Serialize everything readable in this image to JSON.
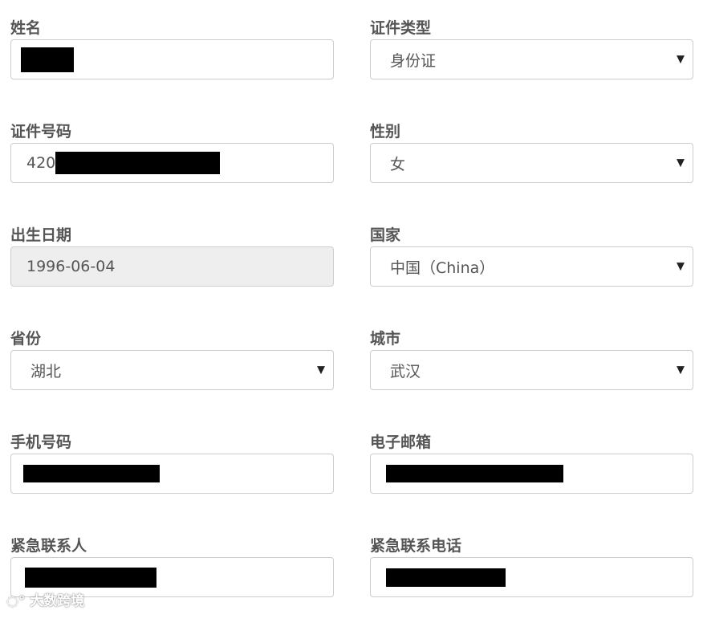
{
  "fields": {
    "name": {
      "label": "姓名"
    },
    "id_type": {
      "label": "证件类型",
      "value": "身份证"
    },
    "id_number": {
      "label": "证件号码",
      "value_prefix": "420"
    },
    "gender": {
      "label": "性别",
      "value": "女"
    },
    "birth_date": {
      "label": "出生日期",
      "value": "1996-06-04"
    },
    "country": {
      "label": "国家",
      "value": "中国（China）"
    },
    "province": {
      "label": "省份",
      "value": "湖北"
    },
    "city": {
      "label": "城市",
      "value": "武汉"
    },
    "phone": {
      "label": "手机号码"
    },
    "email": {
      "label": "电子邮箱"
    },
    "emergency_contact": {
      "label": "紧急联系人"
    },
    "emergency_phone": {
      "label": "紧急联系电话"
    }
  },
  "caret_glyph": "▼",
  "watermark": {
    "text": "大数跨境"
  }
}
